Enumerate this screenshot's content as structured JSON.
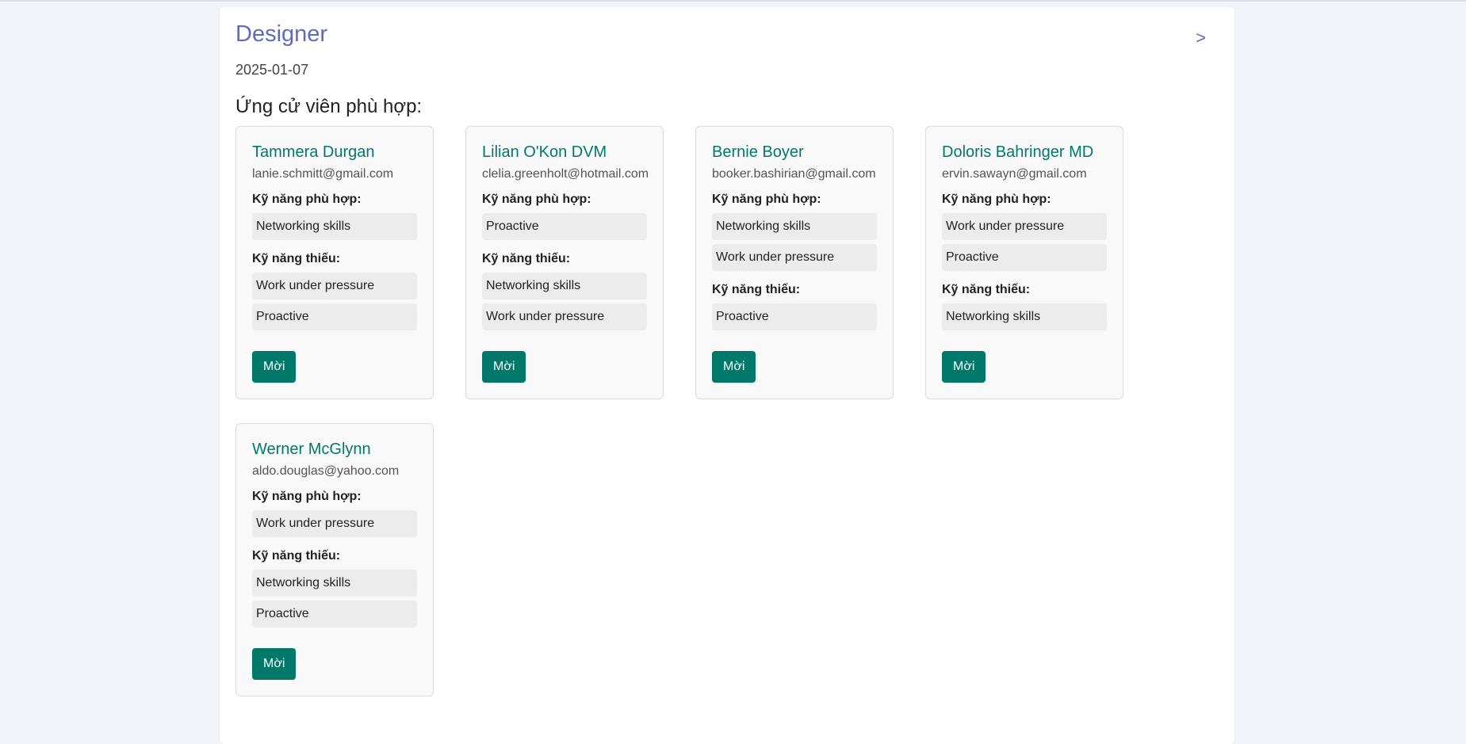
{
  "job": {
    "title": "Designer",
    "date": "2025-01-07",
    "next_label": ">"
  },
  "section_heading": "Ứng cử viên phù hợp:",
  "labels": {
    "matched": "Kỹ năng phù hợp:",
    "missing": "Kỹ năng thiếu:",
    "invite": "Mời"
  },
  "candidates": [
    {
      "name": "Tammera Durgan",
      "email": "lanie.schmitt@gmail.com",
      "matched": [
        "Networking skills"
      ],
      "missing": [
        "Work under pressure",
        "Proactive"
      ]
    },
    {
      "name": "Lilian O'Kon DVM",
      "email": "clelia.greenholt@hotmail.com",
      "matched": [
        "Proactive"
      ],
      "missing": [
        "Networking skills",
        "Work under pressure"
      ]
    },
    {
      "name": "Bernie Boyer",
      "email": "booker.bashirian@gmail.com",
      "matched": [
        "Networking skills",
        "Work under pressure"
      ],
      "missing": [
        "Proactive"
      ]
    },
    {
      "name": "Doloris Bahringer MD",
      "email": "ervin.sawayn@gmail.com",
      "matched": [
        "Work under pressure",
        "Proactive"
      ],
      "missing": [
        "Networking skills"
      ]
    },
    {
      "name": "Werner McGlynn",
      "email": "aldo.douglas@yahoo.com",
      "matched": [
        "Work under pressure"
      ],
      "missing": [
        "Networking skills",
        "Proactive"
      ]
    }
  ]
}
